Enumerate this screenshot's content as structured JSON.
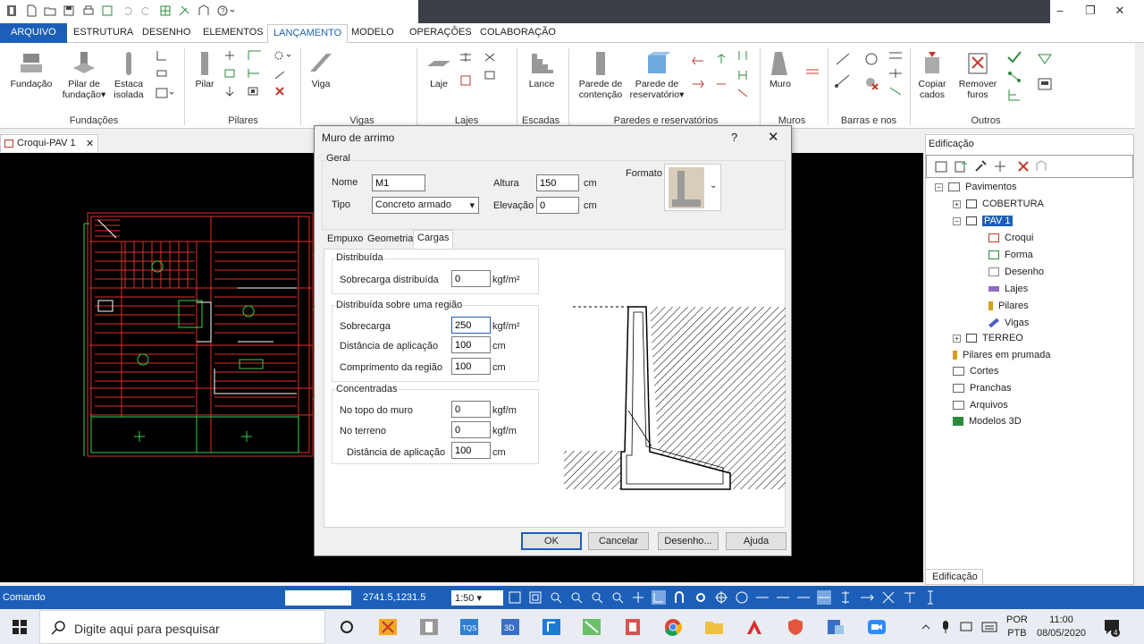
{
  "ribbon": {
    "tabs": [
      "ARQUIVO",
      "ESTRUTURA",
      "DESENHO",
      "ELEMENTOS",
      "LANÇAMENTO",
      "MODELO",
      "OPERAÇÕES",
      "COLABORAÇÃO"
    ],
    "buttons": {
      "fundacao": "Fundação",
      "pilar_fundacao_1": "Pilar de",
      "pilar_fundacao_2": "fundação▾",
      "estaca_1": "Estaca",
      "estaca_2": "isolada",
      "pilar": "Pilar",
      "viga": "Viga",
      "laje": "Laje",
      "lance": "Lance",
      "parede_contencao_1": "Parede de",
      "parede_contencao_2": "contenção",
      "parede_reservatorio_1": "Parede de",
      "parede_reservatorio_2": "reservatório▾",
      "muro": "Muro",
      "copiar_1": "Copiar",
      "copiar_2": "cados",
      "remover_1": "Remover",
      "remover_2": "furos"
    },
    "groups": [
      "Fundações",
      "Pilares",
      "Vigas",
      "Lajes",
      "Escadas",
      "Paredes e reservatórios",
      "Muros",
      "Barras e nos",
      "Outros"
    ]
  },
  "doc_tab": "Croqui-PAV 1",
  "panel": {
    "title": "Edificação",
    "bottom_tab": "Edificação",
    "tree": {
      "root": "Pavimentos",
      "cobertura": "COBERTURA",
      "pav1": "PAV 1",
      "croqui": "Croqui",
      "forma": "Forma",
      "desenho": "Desenho",
      "lajes": "Lajes",
      "pilares": "Pilares",
      "vigas": "Vigas",
      "terreo": "TERREO",
      "pilares_prumada": "Pilares em prumada",
      "cortes": "Cortes",
      "pranchas": "Pranchas",
      "arquivos": "Arquivos",
      "modelos3d": "Modelos 3D"
    }
  },
  "dialog": {
    "title": "Muro de arrimo",
    "help": "?",
    "close": "✕",
    "geral": "Geral",
    "nome_label": "Nome",
    "nome_value": "M1",
    "tipo_label": "Tipo",
    "tipo_value": "Concreto armado",
    "altura_label": "Altura",
    "altura_value": "150",
    "elevacao_label": "Elevação",
    "elevacao_value": "0",
    "unit_cm": "cm",
    "formato_label": "Formato",
    "tabs": [
      "Empuxo",
      "Geometria",
      "Cargas"
    ],
    "distribuida": {
      "legend": "Distribuída",
      "sobrecarga_label": "Sobrecarga distribuída",
      "sobrecarga_value": "0",
      "unit": "kgf/m²"
    },
    "regiao": {
      "legend": "Distribuída sobre uma região",
      "sobrecarga_label": "Sobrecarga",
      "sobrecarga_value": "250",
      "sobrecarga_unit": "kgf/m²",
      "distancia_label": "Distância de aplicação",
      "distancia_value": "100",
      "distancia_unit": "cm",
      "comprimento_label": "Comprimento da região",
      "comprimento_value": "100",
      "comprimento_unit": "cm"
    },
    "concentradas": {
      "legend": "Concentradas",
      "topo_label": "No topo do muro",
      "topo_value": "0",
      "topo_unit": "kgf/m",
      "terreno_label": "No terreno",
      "terreno_value": "0",
      "terreno_unit": "kgf/m",
      "distancia_label": "Distância de aplicação",
      "distancia_value": "100",
      "distancia_unit": "cm"
    },
    "buttons": {
      "ok": "OK",
      "cancelar": "Cancelar",
      "desenho": "Desenho...",
      "ajuda": "Ajuda"
    }
  },
  "status": {
    "comando": "Comando",
    "coords": "2741.5,1231.5",
    "scale": "1:50"
  },
  "taskbar": {
    "search_placeholder": "Digite aqui para pesquisar",
    "lang_1": "POR",
    "lang_2": "PTB",
    "time": "11:00",
    "date": "08/05/2020",
    "notif": "4"
  },
  "colors": {
    "accent": "#1c5fb8",
    "canvas": "#000000",
    "cad_red": "#e0302a",
    "cad_green": "#35d04a"
  }
}
